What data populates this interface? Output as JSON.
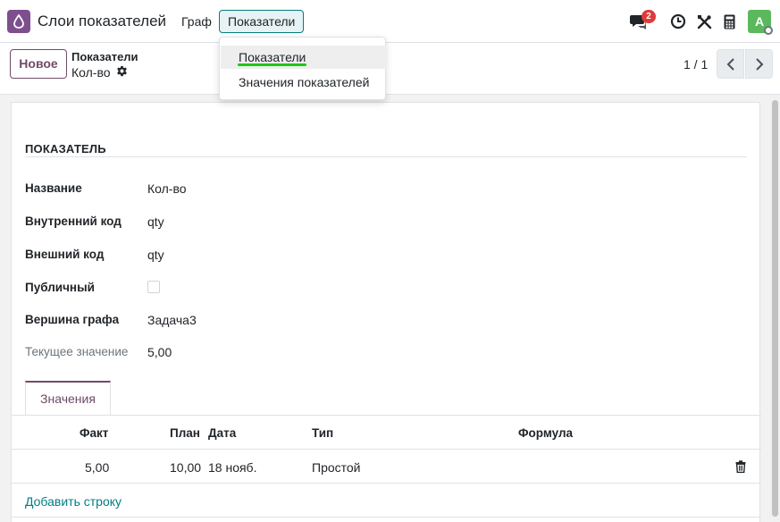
{
  "navbar": {
    "app_title": "Слои показателей",
    "menus": [
      "Граф",
      "Показатели"
    ],
    "chat_count": "2",
    "avatar_letter": "A",
    "colors": {
      "brand": "#714b67",
      "accent": "#017e84",
      "badge": "#e03a3a",
      "avatar": "#5cb85c"
    },
    "icons": [
      "app-logo-icon",
      "chat-icon",
      "clock-icon",
      "tools-icon",
      "calculator-icon"
    ]
  },
  "dropdown": {
    "items": [
      "Показатели",
      "Значения показателей"
    ]
  },
  "control_panel": {
    "new_button": "Новое",
    "breadcrumb_parent": "Показатели",
    "breadcrumb_current": "Кол-во",
    "pager": "1 / 1"
  },
  "form": {
    "section_title": "ПОКАЗАТЕЛЬ",
    "fields": [
      {
        "label": "Название",
        "value": "Кол-во"
      },
      {
        "label": "Внутренний код",
        "value": "qty"
      },
      {
        "label": "Внешний код",
        "value": "qty"
      },
      {
        "label": "Публичный",
        "value": ""
      },
      {
        "label": "Вершина графа",
        "value": "Задача3"
      },
      {
        "label": "Текущее значение",
        "value": "5,00"
      }
    ],
    "public_checked": false
  },
  "tabs": [
    "Значения"
  ],
  "table": {
    "columns": [
      "Факт",
      "План",
      "Дата",
      "Тип",
      "Формула"
    ],
    "rows": [
      {
        "fact": "5,00",
        "plan": "10,00",
        "date": "18 нояб.",
        "type": "Простой",
        "formula": ""
      }
    ],
    "add_row": "Добавить строку"
  }
}
